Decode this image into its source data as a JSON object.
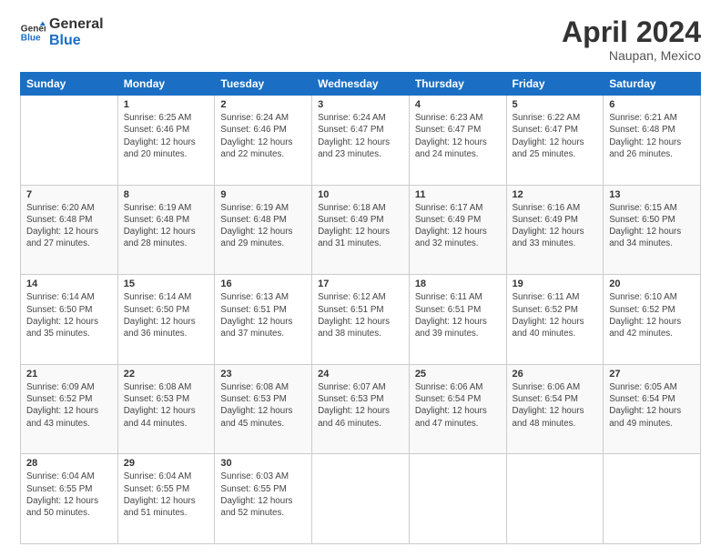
{
  "logo": {
    "text_general": "General",
    "text_blue": "Blue"
  },
  "header": {
    "title": "April 2024",
    "subtitle": "Naupan, Mexico"
  },
  "weekdays": [
    "Sunday",
    "Monday",
    "Tuesday",
    "Wednesday",
    "Thursday",
    "Friday",
    "Saturday"
  ],
  "days": [
    {
      "date": "",
      "info": ""
    },
    {
      "date": "1",
      "info": "Sunrise: 6:25 AM\nSunset: 6:46 PM\nDaylight: 12 hours\nand 20 minutes."
    },
    {
      "date": "2",
      "info": "Sunrise: 6:24 AM\nSunset: 6:46 PM\nDaylight: 12 hours\nand 22 minutes."
    },
    {
      "date": "3",
      "info": "Sunrise: 6:24 AM\nSunset: 6:47 PM\nDaylight: 12 hours\nand 23 minutes."
    },
    {
      "date": "4",
      "info": "Sunrise: 6:23 AM\nSunset: 6:47 PM\nDaylight: 12 hours\nand 24 minutes."
    },
    {
      "date": "5",
      "info": "Sunrise: 6:22 AM\nSunset: 6:47 PM\nDaylight: 12 hours\nand 25 minutes."
    },
    {
      "date": "6",
      "info": "Sunrise: 6:21 AM\nSunset: 6:48 PM\nDaylight: 12 hours\nand 26 minutes."
    },
    {
      "date": "7",
      "info": "Sunrise: 6:20 AM\nSunset: 6:48 PM\nDaylight: 12 hours\nand 27 minutes."
    },
    {
      "date": "8",
      "info": "Sunrise: 6:19 AM\nSunset: 6:48 PM\nDaylight: 12 hours\nand 28 minutes."
    },
    {
      "date": "9",
      "info": "Sunrise: 6:19 AM\nSunset: 6:48 PM\nDaylight: 12 hours\nand 29 minutes."
    },
    {
      "date": "10",
      "info": "Sunrise: 6:18 AM\nSunset: 6:49 PM\nDaylight: 12 hours\nand 31 minutes."
    },
    {
      "date": "11",
      "info": "Sunrise: 6:17 AM\nSunset: 6:49 PM\nDaylight: 12 hours\nand 32 minutes."
    },
    {
      "date": "12",
      "info": "Sunrise: 6:16 AM\nSunset: 6:49 PM\nDaylight: 12 hours\nand 33 minutes."
    },
    {
      "date": "13",
      "info": "Sunrise: 6:15 AM\nSunset: 6:50 PM\nDaylight: 12 hours\nand 34 minutes."
    },
    {
      "date": "14",
      "info": "Sunrise: 6:14 AM\nSunset: 6:50 PM\nDaylight: 12 hours\nand 35 minutes."
    },
    {
      "date": "15",
      "info": "Sunrise: 6:14 AM\nSunset: 6:50 PM\nDaylight: 12 hours\nand 36 minutes."
    },
    {
      "date": "16",
      "info": "Sunrise: 6:13 AM\nSunset: 6:51 PM\nDaylight: 12 hours\nand 37 minutes."
    },
    {
      "date": "17",
      "info": "Sunrise: 6:12 AM\nSunset: 6:51 PM\nDaylight: 12 hours\nand 38 minutes."
    },
    {
      "date": "18",
      "info": "Sunrise: 6:11 AM\nSunset: 6:51 PM\nDaylight: 12 hours\nand 39 minutes."
    },
    {
      "date": "19",
      "info": "Sunrise: 6:11 AM\nSunset: 6:52 PM\nDaylight: 12 hours\nand 40 minutes."
    },
    {
      "date": "20",
      "info": "Sunrise: 6:10 AM\nSunset: 6:52 PM\nDaylight: 12 hours\nand 42 minutes."
    },
    {
      "date": "21",
      "info": "Sunrise: 6:09 AM\nSunset: 6:52 PM\nDaylight: 12 hours\nand 43 minutes."
    },
    {
      "date": "22",
      "info": "Sunrise: 6:08 AM\nSunset: 6:53 PM\nDaylight: 12 hours\nand 44 minutes."
    },
    {
      "date": "23",
      "info": "Sunrise: 6:08 AM\nSunset: 6:53 PM\nDaylight: 12 hours\nand 45 minutes."
    },
    {
      "date": "24",
      "info": "Sunrise: 6:07 AM\nSunset: 6:53 PM\nDaylight: 12 hours\nand 46 minutes."
    },
    {
      "date": "25",
      "info": "Sunrise: 6:06 AM\nSunset: 6:54 PM\nDaylight: 12 hours\nand 47 minutes."
    },
    {
      "date": "26",
      "info": "Sunrise: 6:06 AM\nSunset: 6:54 PM\nDaylight: 12 hours\nand 48 minutes."
    },
    {
      "date": "27",
      "info": "Sunrise: 6:05 AM\nSunset: 6:54 PM\nDaylight: 12 hours\nand 49 minutes."
    },
    {
      "date": "28",
      "info": "Sunrise: 6:04 AM\nSunset: 6:55 PM\nDaylight: 12 hours\nand 50 minutes."
    },
    {
      "date": "29",
      "info": "Sunrise: 6:04 AM\nSunset: 6:55 PM\nDaylight: 12 hours\nand 51 minutes."
    },
    {
      "date": "30",
      "info": "Sunrise: 6:03 AM\nSunset: 6:55 PM\nDaylight: 12 hours\nand 52 minutes."
    },
    {
      "date": "",
      "info": ""
    },
    {
      "date": "",
      "info": ""
    },
    {
      "date": "",
      "info": ""
    },
    {
      "date": "",
      "info": ""
    }
  ]
}
